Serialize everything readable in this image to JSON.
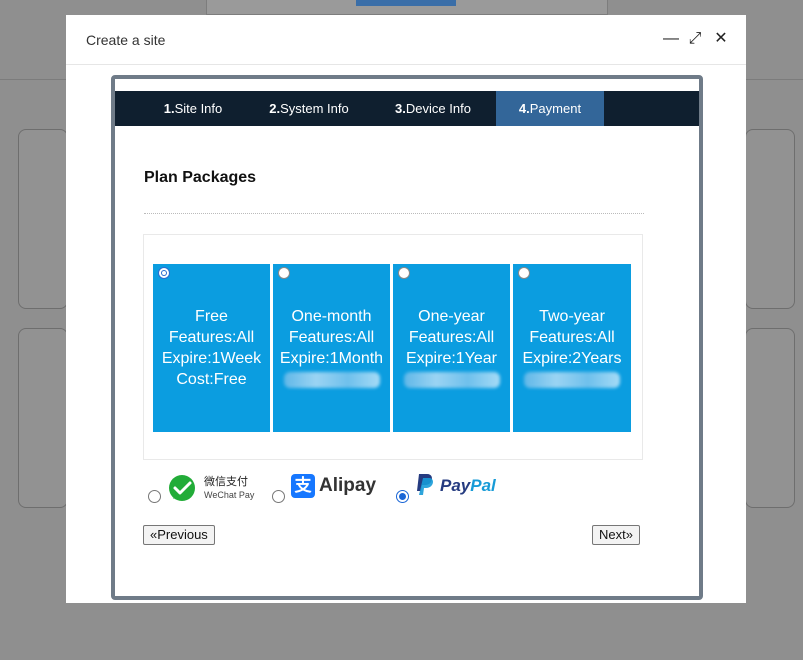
{
  "modal": {
    "title": "Create a site",
    "minimize_glyph": "—",
    "maximize_glyph": "⤢",
    "close_glyph": "✕"
  },
  "steps": [
    {
      "num": "1.",
      "label": "Site Info"
    },
    {
      "num": "2.",
      "label": "System Info"
    },
    {
      "num": "3.",
      "label": "Device Info"
    },
    {
      "num": "4.",
      "label": "Payment",
      "active": true
    }
  ],
  "section_title": "Plan Packages",
  "plans": [
    {
      "name": "Free",
      "features": "Features:All",
      "expire": "Expire:1Week",
      "cost": "Cost:Free",
      "selected": true
    },
    {
      "name": "One-month",
      "features": "Features:All",
      "expire": "Expire:1Month",
      "cost": ""
    },
    {
      "name": "One-year",
      "features": "Features:All",
      "expire": "Expire:1Year",
      "cost": ""
    },
    {
      "name": "Two-year",
      "features": "Features:All",
      "expire": "Expire:2Years",
      "cost": ""
    }
  ],
  "payment_methods": {
    "wechat": {
      "line1": "微信支付",
      "line2": "WeChat Pay"
    },
    "alipay": {
      "glyph": "支",
      "label": "Alipay"
    },
    "paypal": {
      "label_a": "Pay",
      "label_b": "Pal"
    },
    "selected": "paypal"
  },
  "buttons": {
    "previous": "«Previous",
    "next": "Next»"
  },
  "colors": {
    "plan_bg": "#0b9de0",
    "step_bar": "#0f1f2f",
    "step_active": "#336699"
  }
}
